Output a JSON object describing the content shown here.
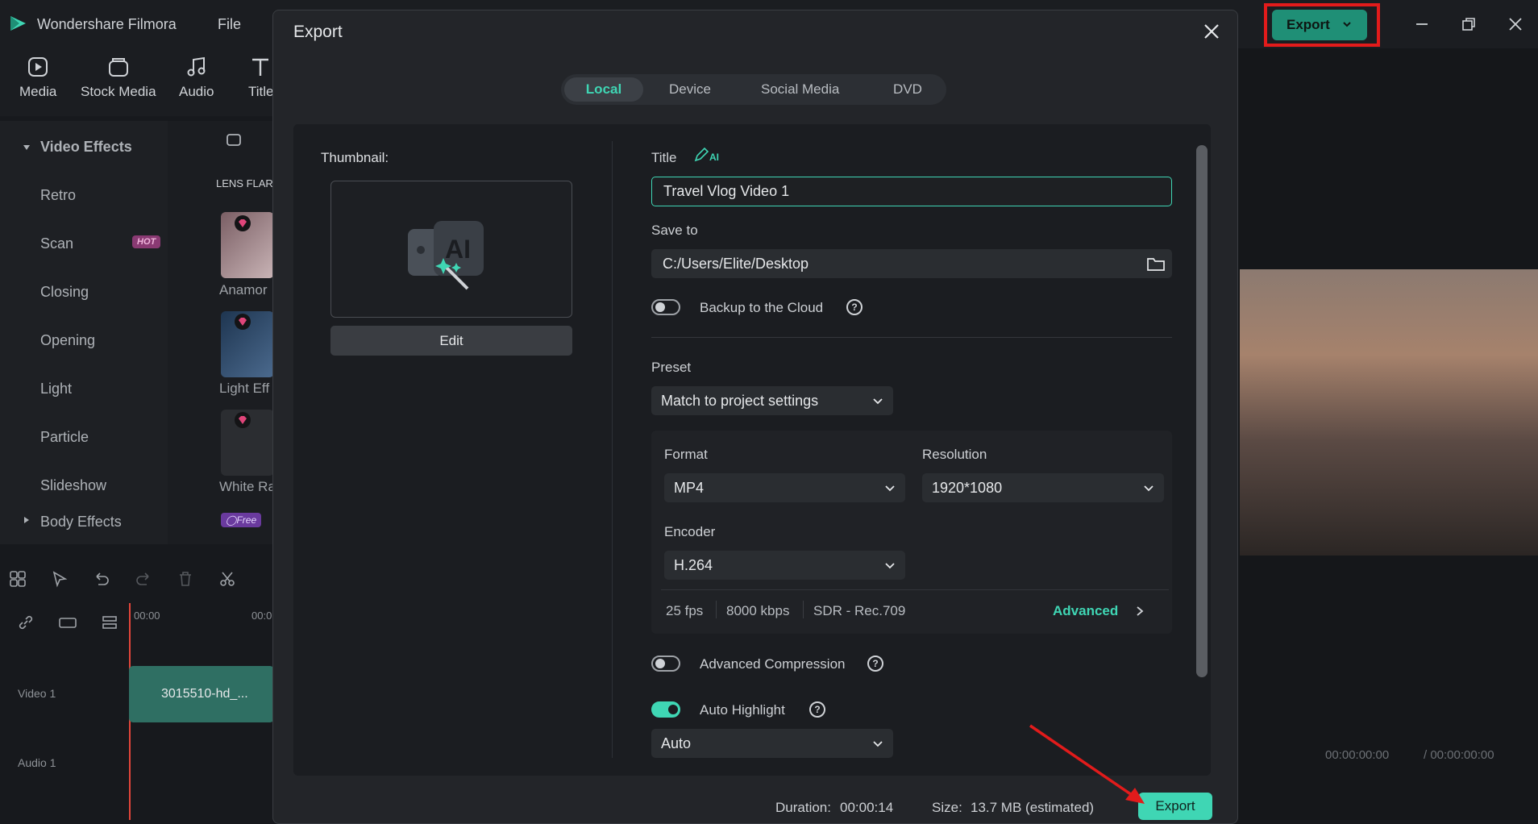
{
  "app": {
    "name": "Wondershare Filmora",
    "menu_file": "File"
  },
  "top_export": {
    "label": "Export"
  },
  "toolbar": [
    {
      "label": "Media"
    },
    {
      "label": "Stock Media"
    },
    {
      "label": "Audio"
    },
    {
      "label": "Title"
    }
  ],
  "sidebar": {
    "group_video": "Video Effects",
    "items": [
      "Retro",
      "Scan",
      "Closing",
      "Opening",
      "Light",
      "Particle",
      "Slideshow"
    ],
    "hot_badge": "HOT",
    "group_body": "Body Effects"
  },
  "effects": {
    "section": "LENS FLAR",
    "cards": [
      "Anamor",
      "Light Eff",
      "White Ra"
    ],
    "free_badge": "Free"
  },
  "timeline": {
    "ruler": [
      "00:00",
      "00:0"
    ],
    "video_track": "Video 1",
    "audio_track": "Audio 1",
    "clip_name": "3015510-hd_..."
  },
  "player": {
    "current": "00:00:00:00",
    "total": "/ 00:00:00:00"
  },
  "dialog": {
    "title": "Export",
    "tabs": {
      "active": "Local",
      "others": [
        "Device",
        "Social Media",
        "DVD"
      ]
    },
    "thumbnail_label": "Thumbnail:",
    "edit_label": "Edit",
    "title_label": "Title",
    "title_value": "Travel Vlog Video 1",
    "ai_tag": "AI",
    "save_to_label": "Save to",
    "save_to_value": "C:/Users/Elite/Desktop",
    "backup_label": "Backup to the Cloud",
    "preset_label": "Preset",
    "preset_value": "Match to project settings",
    "format_label": "Format",
    "format_value": "MP4",
    "resolution_label": "Resolution",
    "resolution_value": "1920*1080",
    "encoder_label": "Encoder",
    "encoder_value": "H.264",
    "specs": [
      "25 fps",
      "8000 kbps",
      "SDR - Rec.709"
    ],
    "advanced_label": "Advanced",
    "compression_label": "Advanced Compression",
    "highlight_label": "Auto Highlight",
    "highlight_value": "Auto",
    "backup_on": false,
    "compression_on": false,
    "highlight_on": true,
    "duration_label": "Duration:",
    "duration_value": "00:00:14",
    "size_label": "Size:",
    "size_value": "13.7 MB (estimated)",
    "export_label": "Export"
  },
  "colors": {
    "accent": "#3fd6b4",
    "highlight_box": "#e21b1b",
    "arrow": "#e21b1b"
  }
}
